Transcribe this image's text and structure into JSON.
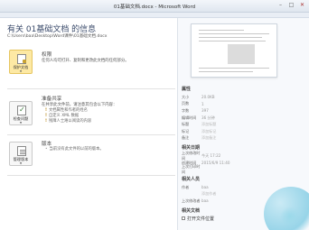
{
  "window": {
    "title": "01基础文档.docx - Microsoft Word"
  },
  "info": {
    "heading": "有关 01基础文档 的信息",
    "path": "C:\\Users\\baa\\Desktop\\Word课件\\01基础文档.docx"
  },
  "sections": [
    {
      "button_label": "保护文档",
      "title": "权限",
      "description": "任何人均可打开、复制和更改此文档的任何部分。",
      "bullets": []
    },
    {
      "button_label": "检查问题",
      "title": "准备共享",
      "description": "在共享此文件前，请注意其包含以下内容：",
      "bullets": [
        "文档属性和作者的姓名",
        "自定义 XML 数据",
        "残障人士难以阅读的内容"
      ]
    },
    {
      "button_label": "管理版本",
      "title": "版本",
      "description": "",
      "bullets": [
        "当前没有此文件的以前的版本。"
      ]
    }
  ],
  "properties": {
    "header": "属性",
    "rows": [
      {
        "key": "大小",
        "value": "20.0KB"
      },
      {
        "key": "页数",
        "value": "1"
      },
      {
        "key": "字数",
        "value": "397"
      },
      {
        "key": "编辑时间",
        "value": "36 分钟"
      },
      {
        "key": "标题",
        "value": "添加标题"
      },
      {
        "key": "标记",
        "value": "添加标记"
      },
      {
        "key": "备注",
        "value": "添加备注"
      }
    ],
    "dates_header": "相关日期",
    "dates": [
      {
        "key": "上次修改时间",
        "value": "今天 17:22"
      },
      {
        "key": "创建时间",
        "value": "2015/6/9 11:40"
      },
      {
        "key": "上次打印时间",
        "value": ""
      }
    ],
    "people_header": "相关人员",
    "people": [
      {
        "key": "作者",
        "value": "baa"
      },
      {
        "key": "",
        "value": "添加作者"
      },
      {
        "key": "上次修改者",
        "value": "baa"
      }
    ],
    "docs_header": "相关文档",
    "docs": [
      {
        "label": "打开文件位置"
      }
    ]
  }
}
